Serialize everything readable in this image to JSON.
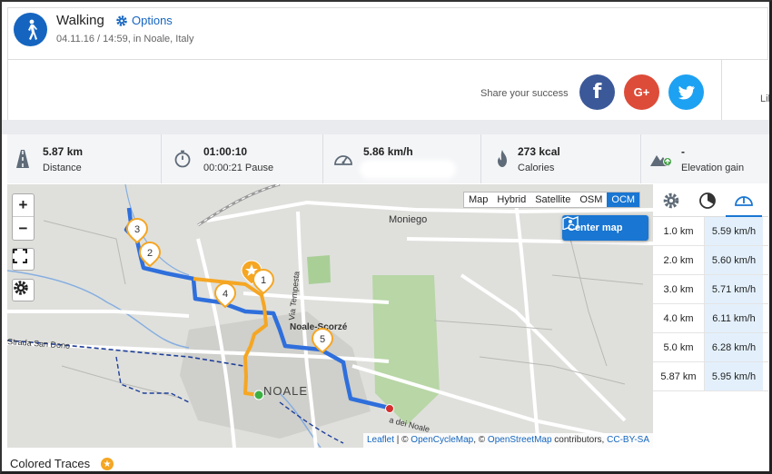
{
  "header": {
    "title": "Walking",
    "options_label": "Options",
    "subtitle": "04.11.16 / 14:59, in Noale, Italy",
    "activity_icon": "walking-person-icon"
  },
  "share": {
    "label": "Share your success",
    "facebook": "f",
    "google": "G+",
    "twitter": "twitter-bird-icon",
    "like_partial": "Lik"
  },
  "stats": [
    {
      "value": "5.87 km",
      "label": "Distance",
      "icon": "road-icon"
    },
    {
      "value": "01:00:10",
      "label": "00:00:21 Pause",
      "icon": "stopwatch-icon"
    },
    {
      "value": "5.86 km/h",
      "label": "",
      "icon": "speedometer-icon"
    },
    {
      "value": "273 kcal",
      "label": "Calories",
      "icon": "flame-icon"
    },
    {
      "value": "-",
      "label": "Elevation gain",
      "icon": "mountain-icon"
    }
  ],
  "map": {
    "layers": [
      "Map",
      "Hybrid",
      "Satellite",
      "OSM",
      "OCM"
    ],
    "active_layer": "OCM",
    "center_button": "Center map",
    "labels": {
      "moniego": "Moniego",
      "noale_scorze": "Noale-Scorzé",
      "noale": "NOALE",
      "via_tempesta": "Via Tempesta",
      "strada": "Strada San Dono",
      "via_noale": "a dei Noale"
    },
    "markers": [
      "1",
      "2",
      "3",
      "4",
      "5"
    ],
    "attribution": {
      "leaflet": "Leaflet",
      "sep1": " | © ",
      "ocm": "OpenCycleMap",
      "sep2": ", © ",
      "osm": "OpenStreetMap",
      "contrib": " contributors, ",
      "license": "CC-BY-SA"
    },
    "colors": {
      "route_main": "#2f6fdc",
      "route_segment": "#f5a623",
      "start": "#3cb043",
      "end": "#d32f2f"
    }
  },
  "splits": [
    {
      "km": "1.0 km",
      "speed": "5.59 km/h"
    },
    {
      "km": "2.0 km",
      "speed": "5.60 km/h"
    },
    {
      "km": "3.0 km",
      "speed": "5.71 km/h"
    },
    {
      "km": "4.0 km",
      "speed": "6.11 km/h"
    },
    {
      "km": "5.0 km",
      "speed": "6.28 km/h"
    },
    {
      "km": "5.87 km",
      "speed": "5.95 km/h"
    }
  ],
  "footer": {
    "title": "Colored Traces"
  }
}
